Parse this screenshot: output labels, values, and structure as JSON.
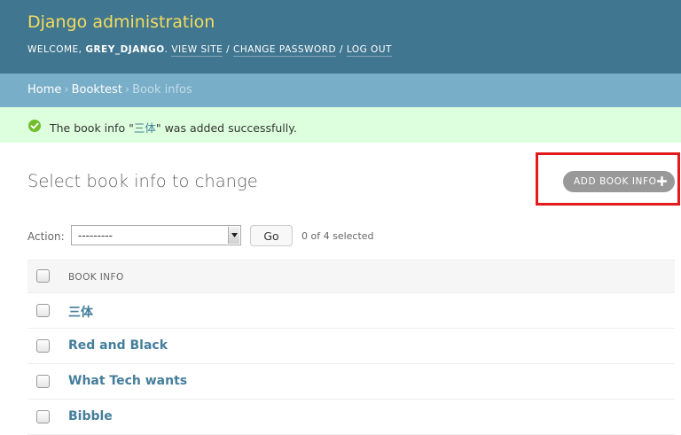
{
  "header": {
    "site_name": "Django administration",
    "welcome_text": "WELCOME,",
    "username": "GREY_DJANGO",
    "view_site": "VIEW SITE",
    "change_password": "CHANGE PASSWORD",
    "log_out": "LOG OUT",
    "separator": "/"
  },
  "breadcrumbs": {
    "home": "Home",
    "app": "Booktest",
    "current": "Book infos",
    "separator": "›"
  },
  "message": {
    "prefix": "The book info \"",
    "object_name": "三体",
    "suffix": "\" was added successfully.",
    "icon": "check-circle-icon"
  },
  "content": {
    "title": "Select book info to change",
    "add_button": "ADD BOOK INFO"
  },
  "actions": {
    "label": "Action:",
    "selected_option": "---------",
    "go_label": "Go",
    "counter": "0 of 4 selected"
  },
  "table": {
    "column_header": "BOOK INFO",
    "rows": [
      {
        "title": "三体"
      },
      {
        "title": "Red and Black"
      },
      {
        "title": "What Tech wants"
      },
      {
        "title": "Bibble"
      }
    ]
  },
  "colors": {
    "header_bg": "#417690",
    "site_name": "#f5dd5d",
    "breadcrumb_bg": "#79aec8",
    "success_bg": "#dddddd",
    "link": "#447e9b",
    "highlight": "#e31a1c"
  }
}
